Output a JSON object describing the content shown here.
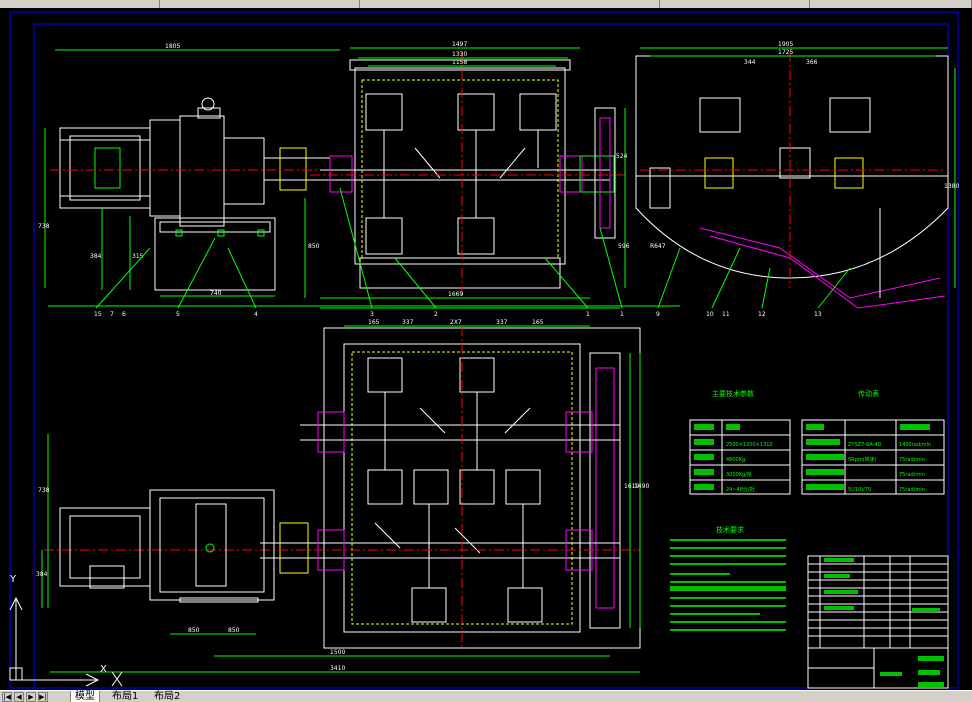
{
  "colors": {
    "background": "#000000",
    "frame": "#0000ff",
    "outline": "#ffffff",
    "dimension": "#00ff00",
    "centerline": "#ff0000",
    "hidden": "#ffff00",
    "accent": "#ff00ff",
    "paddle": "#ffffff",
    "table_fill": "#00c000",
    "ui_gray": "#d4d0c8"
  },
  "topbar": {
    "title": ""
  },
  "dims_top": {
    "left_width": "1805",
    "mid_outer": "1497",
    "mid_inner": "1330",
    "mid_core": "1158",
    "right_width": "1905",
    "right_sub": "1725",
    "right_a": "344",
    "right_b": "366",
    "height_left": "738",
    "height_left_base": "384",
    "height_left_b": "315",
    "height_mid": "850",
    "height_right": "1380",
    "base_width": "740",
    "mid_base": "1669",
    "mid_side": "524",
    "right_radius": "R647",
    "right_h": "596"
  },
  "dims_bottom": {
    "top_a": "165",
    "top_b": "337",
    "top_c": "2X7",
    "top_d": "337",
    "top_e": "165",
    "height_total": "738",
    "height_base": "384",
    "right_a": "1619",
    "right_b": "1490",
    "base_a": "850",
    "base_b": "850",
    "bottom_a": "1500",
    "bottom_b": "3410"
  },
  "balloons_top": [
    "15",
    "7",
    "6",
    "5",
    "4",
    "3",
    "2",
    "1",
    "1",
    "9",
    "10",
    "11",
    "12",
    "13"
  ],
  "tables": {
    "params_title": "主要技术参数",
    "motor_title": "传动表",
    "params_rows": [
      "",
      "2500×1200×1310",
      "4800Kg",
      "3000Kg/批",
      "24~48分/批"
    ],
    "motor_rows": [
      "ZYSZ7-6A-4D",
      "5Rpm(转速)",
      "",
      "5(/10)/70"
    ],
    "motor_right": [
      "1400rad/min",
      "75rad/min",
      "75rad/min",
      "75rad/min"
    ],
    "notes_title": "技术要求"
  },
  "tabs": {
    "model": "模型",
    "layout1": "布局1",
    "layout2": "布局2"
  },
  "axis": {
    "x": "X",
    "y": "Y"
  }
}
